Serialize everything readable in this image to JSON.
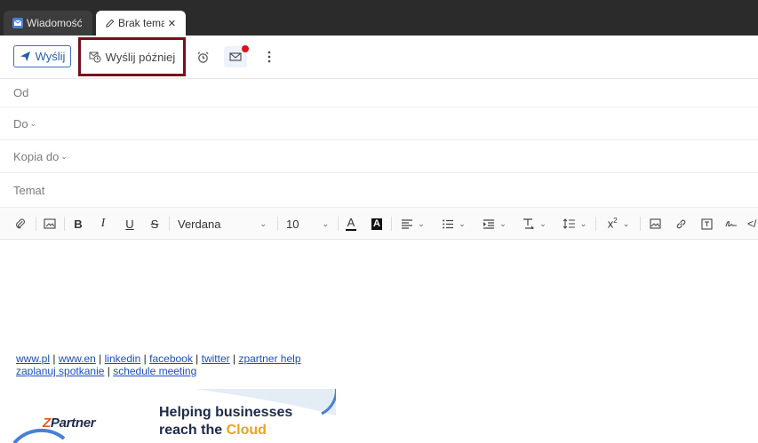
{
  "tabs": [
    {
      "label": "Wiadomość",
      "active": false
    },
    {
      "label": "Brak tematu",
      "active": true
    }
  ],
  "toolbar": {
    "send_label": "Wyślij",
    "send_later_label": "Wyślij później"
  },
  "fields": {
    "from": "Od",
    "to": "Do",
    "cc": "Kopia do",
    "subject": "Temat"
  },
  "format": {
    "font": "Verdana",
    "size": "10"
  },
  "signature": {
    "links_row1": [
      "www.pl",
      "www.en",
      "linkedin",
      "facebook",
      "twitter",
      "zpartner help"
    ],
    "links_row2": [
      "zaplanuj spotkanie",
      "schedule meeting"
    ],
    "separator": " | "
  },
  "banner": {
    "logo": "ZPartner",
    "logo_mark": "Z",
    "logo_rest": "Partner",
    "headline_line1": "Helping businesses",
    "headline_line2_a": "reach the ",
    "headline_line2_b": "Cloud"
  },
  "colors": {
    "accent": "#2a5db0",
    "highlight_border": "#7a0f1c",
    "notification_dot": "#e0101a",
    "brand_orange": "#f0a21c"
  }
}
